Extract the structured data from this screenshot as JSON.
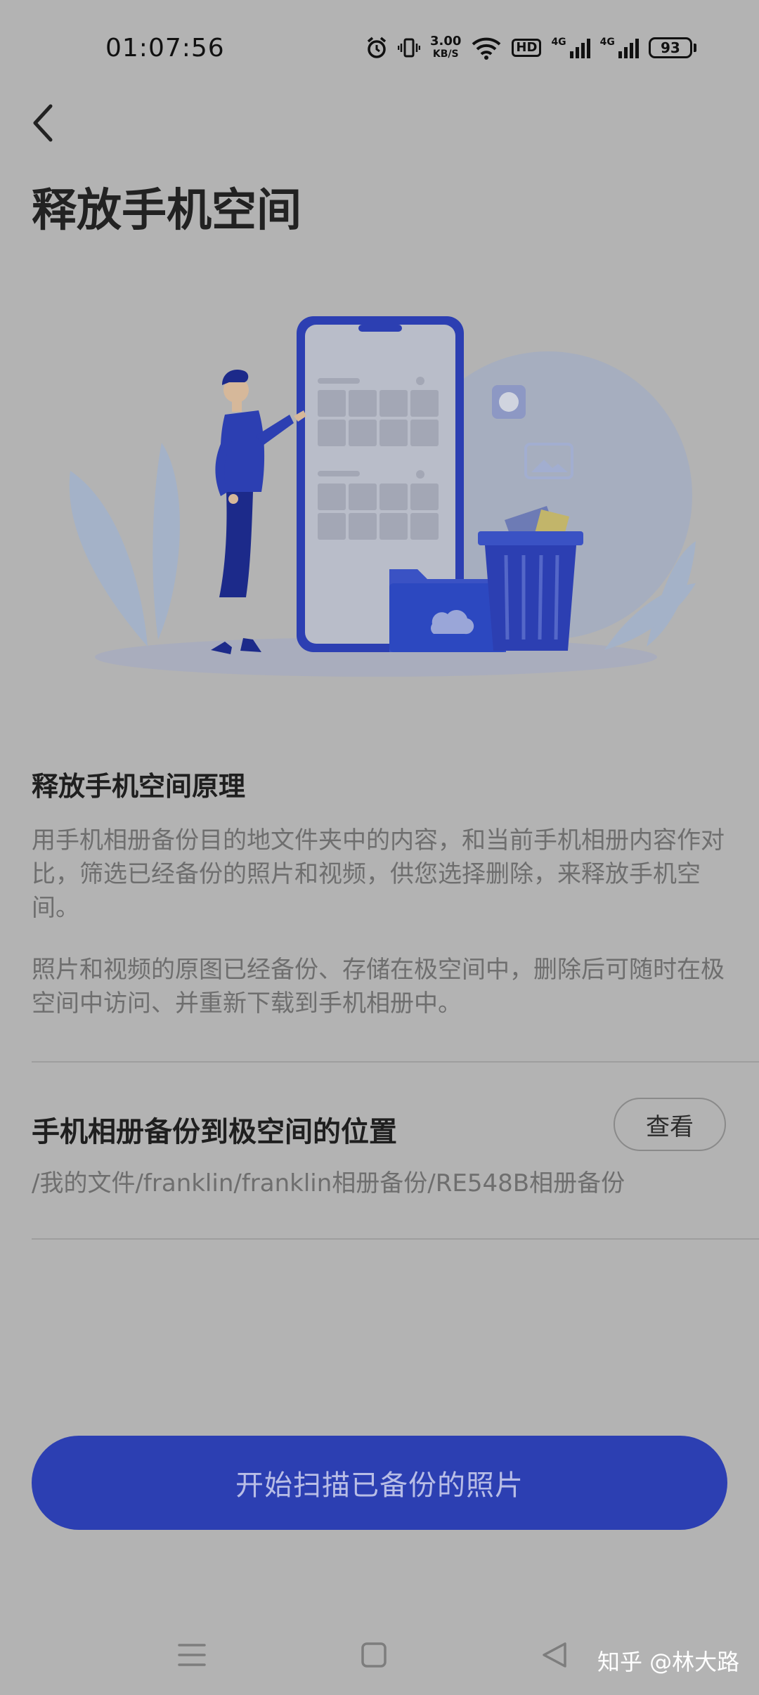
{
  "status_bar": {
    "time": "01:07:56",
    "net_speed_value": "3.00",
    "net_speed_unit": "KB/S",
    "hd_label": "HD",
    "sim1_label": "4G",
    "sim2_label": "4G",
    "battery": "93"
  },
  "header": {
    "back_icon": "chevron-left-icon",
    "title": "释放手机空间"
  },
  "principle": {
    "title": "释放手机空间原理",
    "para1": "用手机相册备份目的地文件夹中的内容，和当前手机相册内容作对比，筛选已经备份的照片和视频，供您选择删除，来释放手机空间。",
    "para2": "照片和视频的原图已经备份、存储在极空间中，删除后可随时在极空间中访问、并重新下载到手机相册中。"
  },
  "backup_location": {
    "title": "手机相册备份到极空间的位置",
    "view_label": "查看",
    "path": "/我的文件/franklin/franklin相册备份/RE548B相册备份"
  },
  "primary_action": {
    "label": "开始扫描已备份的照片"
  },
  "nav_bar": {
    "menu_icon": "menu-icon",
    "home_icon": "square-home-icon",
    "back_icon": "triangle-back-icon"
  },
  "watermark": "知乎 @林大路",
  "colors": {
    "background": "#b3b3b3",
    "primary_button": "#2c3fb2",
    "primary_button_text": "#b8bde6",
    "body_text": "#6e6e6e"
  }
}
